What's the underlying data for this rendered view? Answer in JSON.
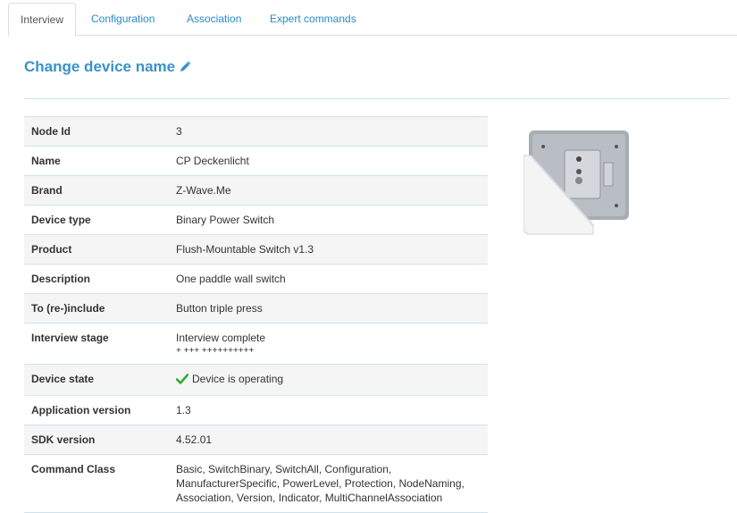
{
  "tabs": [
    {
      "label": "Interview"
    },
    {
      "label": "Configuration"
    },
    {
      "label": "Association"
    },
    {
      "label": "Expert commands"
    }
  ],
  "title": "Change device name",
  "icons": {
    "edit": "pencil-icon",
    "state": "checkmark-icon",
    "device": "wall-switch-image"
  },
  "colors": {
    "link": "#2a8ac6",
    "title": "#3a91c9",
    "check": "#3aa63a",
    "border": "#cfe3ef"
  },
  "rows": {
    "node_id": {
      "label": "Node Id",
      "value": "3"
    },
    "name": {
      "label": "Name",
      "value": "CP Deckenlicht"
    },
    "brand": {
      "label": "Brand",
      "value": "Z-Wave.Me"
    },
    "device_type": {
      "label": "Device type",
      "value": "Binary Power Switch"
    },
    "product": {
      "label": "Product",
      "value": "Flush-Mountable Switch v1.3"
    },
    "description": {
      "label": "Description",
      "value": "One paddle wall switch"
    },
    "reinclude": {
      "label": "To (re-)include",
      "value": "Button triple press"
    },
    "interview_stage": {
      "label": "Interview stage",
      "value": "Interview complete",
      "detail": "+ +++ ++++++++++"
    },
    "device_state": {
      "label": "Device state",
      "value": "Device is operating"
    },
    "app_version": {
      "label": "Application version",
      "value": "1.3"
    },
    "sdk_version": {
      "label": "SDK version",
      "value": "4.52.01"
    },
    "command_class": {
      "label": "Command Class",
      "value": "Basic, SwitchBinary, SwitchAll, Configuration, ManufacturerSpecific, PowerLevel, Protection, NodeNaming, Association, Version, Indicator, MultiChannelAssociation"
    }
  }
}
